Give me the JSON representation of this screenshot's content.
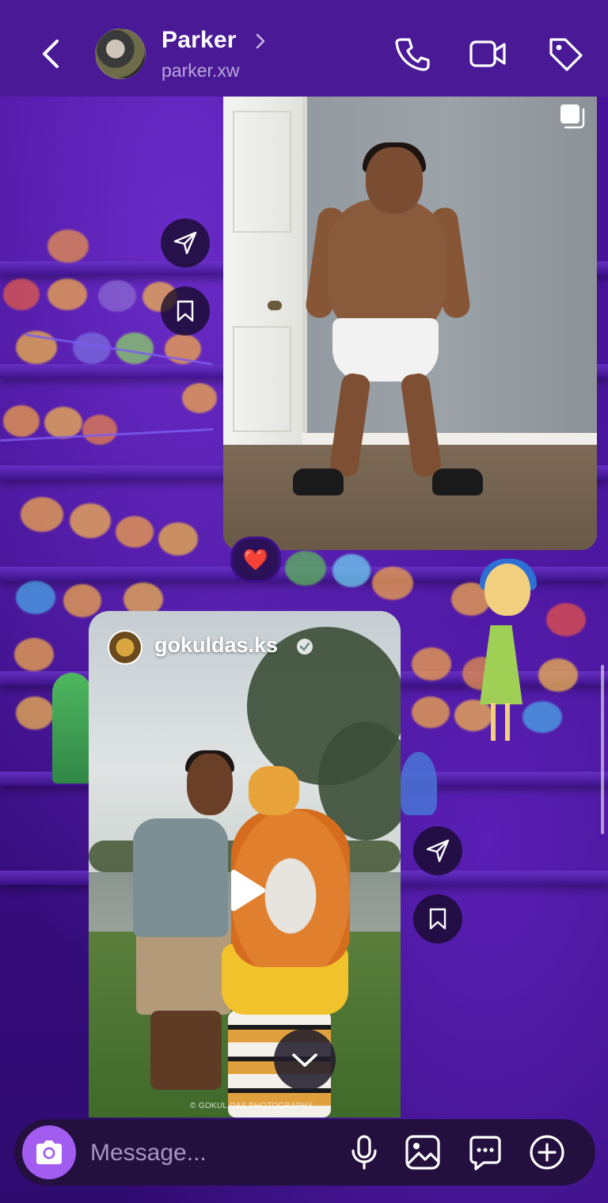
{
  "header": {
    "contact_name": "Parker",
    "contact_handle": "parker.xw",
    "icons": [
      "back-arrow-icon",
      "chevron-right-icon",
      "phone-icon",
      "video-camera-icon",
      "tag-icon"
    ]
  },
  "messages": [
    {
      "kind": "photo",
      "icons": [
        "multiple-photos-icon",
        "send-icon",
        "bookmark-icon"
      ],
      "reaction": "❤️"
    },
    {
      "kind": "reel",
      "author": "gokuldas.ks",
      "verified": true,
      "watermark": "© GOKUL DAS PHOTOGRAPHY",
      "icons": [
        "play-icon",
        "send-icon",
        "bookmark-icon"
      ]
    }
  ],
  "scroll_down_icon": "chevron-down-icon",
  "composer": {
    "placeholder": "Message...",
    "icons": [
      "camera-icon",
      "microphone-icon",
      "image-icon",
      "chat-sticker-icon",
      "add-circle-icon"
    ]
  },
  "colors": {
    "accent": "#a35cf0",
    "header": "#4a1a96",
    "theme_bg": "#3d0f8a"
  }
}
